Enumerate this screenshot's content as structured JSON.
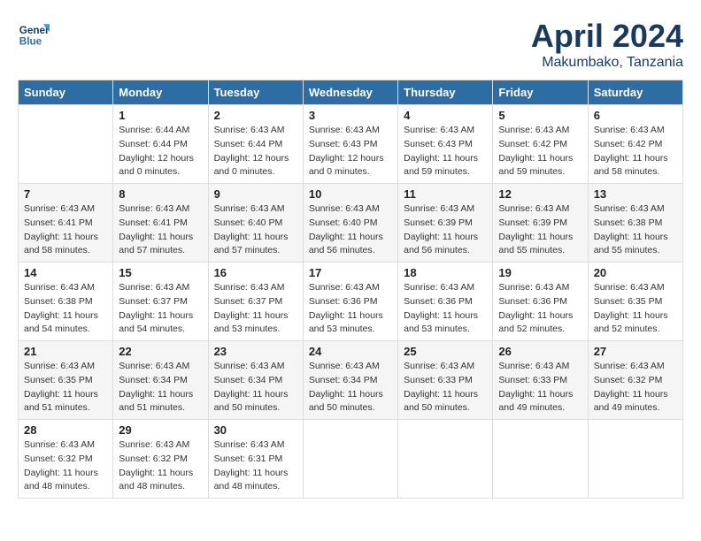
{
  "header": {
    "logo_line1": "General",
    "logo_line2": "Blue",
    "title": "April 2024",
    "subtitle": "Makumbako, Tanzania"
  },
  "weekdays": [
    "Sunday",
    "Monday",
    "Tuesday",
    "Wednesday",
    "Thursday",
    "Friday",
    "Saturday"
  ],
  "weeks": [
    [
      {
        "day": null,
        "info": null
      },
      {
        "day": "1",
        "sunrise": "6:44 AM",
        "sunset": "6:44 PM",
        "daylight": "12 hours and 0 minutes."
      },
      {
        "day": "2",
        "sunrise": "6:43 AM",
        "sunset": "6:44 PM",
        "daylight": "12 hours and 0 minutes."
      },
      {
        "day": "3",
        "sunrise": "6:43 AM",
        "sunset": "6:43 PM",
        "daylight": "12 hours and 0 minutes."
      },
      {
        "day": "4",
        "sunrise": "6:43 AM",
        "sunset": "6:43 PM",
        "daylight": "11 hours and 59 minutes."
      },
      {
        "day": "5",
        "sunrise": "6:43 AM",
        "sunset": "6:42 PM",
        "daylight": "11 hours and 59 minutes."
      },
      {
        "day": "6",
        "sunrise": "6:43 AM",
        "sunset": "6:42 PM",
        "daylight": "11 hours and 58 minutes."
      }
    ],
    [
      {
        "day": "7",
        "sunrise": "6:43 AM",
        "sunset": "6:41 PM",
        "daylight": "11 hours and 58 minutes."
      },
      {
        "day": "8",
        "sunrise": "6:43 AM",
        "sunset": "6:41 PM",
        "daylight": "11 hours and 57 minutes."
      },
      {
        "day": "9",
        "sunrise": "6:43 AM",
        "sunset": "6:40 PM",
        "daylight": "11 hours and 57 minutes."
      },
      {
        "day": "10",
        "sunrise": "6:43 AM",
        "sunset": "6:40 PM",
        "daylight": "11 hours and 56 minutes."
      },
      {
        "day": "11",
        "sunrise": "6:43 AM",
        "sunset": "6:39 PM",
        "daylight": "11 hours and 56 minutes."
      },
      {
        "day": "12",
        "sunrise": "6:43 AM",
        "sunset": "6:39 PM",
        "daylight": "11 hours and 55 minutes."
      },
      {
        "day": "13",
        "sunrise": "6:43 AM",
        "sunset": "6:38 PM",
        "daylight": "11 hours and 55 minutes."
      }
    ],
    [
      {
        "day": "14",
        "sunrise": "6:43 AM",
        "sunset": "6:38 PM",
        "daylight": "11 hours and 54 minutes."
      },
      {
        "day": "15",
        "sunrise": "6:43 AM",
        "sunset": "6:37 PM",
        "daylight": "11 hours and 54 minutes."
      },
      {
        "day": "16",
        "sunrise": "6:43 AM",
        "sunset": "6:37 PM",
        "daylight": "11 hours and 53 minutes."
      },
      {
        "day": "17",
        "sunrise": "6:43 AM",
        "sunset": "6:36 PM",
        "daylight": "11 hours and 53 minutes."
      },
      {
        "day": "18",
        "sunrise": "6:43 AM",
        "sunset": "6:36 PM",
        "daylight": "11 hours and 53 minutes."
      },
      {
        "day": "19",
        "sunrise": "6:43 AM",
        "sunset": "6:36 PM",
        "daylight": "11 hours and 52 minutes."
      },
      {
        "day": "20",
        "sunrise": "6:43 AM",
        "sunset": "6:35 PM",
        "daylight": "11 hours and 52 minutes."
      }
    ],
    [
      {
        "day": "21",
        "sunrise": "6:43 AM",
        "sunset": "6:35 PM",
        "daylight": "11 hours and 51 minutes."
      },
      {
        "day": "22",
        "sunrise": "6:43 AM",
        "sunset": "6:34 PM",
        "daylight": "11 hours and 51 minutes."
      },
      {
        "day": "23",
        "sunrise": "6:43 AM",
        "sunset": "6:34 PM",
        "daylight": "11 hours and 50 minutes."
      },
      {
        "day": "24",
        "sunrise": "6:43 AM",
        "sunset": "6:34 PM",
        "daylight": "11 hours and 50 minutes."
      },
      {
        "day": "25",
        "sunrise": "6:43 AM",
        "sunset": "6:33 PM",
        "daylight": "11 hours and 50 minutes."
      },
      {
        "day": "26",
        "sunrise": "6:43 AM",
        "sunset": "6:33 PM",
        "daylight": "11 hours and 49 minutes."
      },
      {
        "day": "27",
        "sunrise": "6:43 AM",
        "sunset": "6:32 PM",
        "daylight": "11 hours and 49 minutes."
      }
    ],
    [
      {
        "day": "28",
        "sunrise": "6:43 AM",
        "sunset": "6:32 PM",
        "daylight": "11 hours and 48 minutes."
      },
      {
        "day": "29",
        "sunrise": "6:43 AM",
        "sunset": "6:32 PM",
        "daylight": "11 hours and 48 minutes."
      },
      {
        "day": "30",
        "sunrise": "6:43 AM",
        "sunset": "6:31 PM",
        "daylight": "11 hours and 48 minutes."
      },
      {
        "day": null,
        "info": null
      },
      {
        "day": null,
        "info": null
      },
      {
        "day": null,
        "info": null
      },
      {
        "day": null,
        "info": null
      }
    ]
  ],
  "labels": {
    "sunrise": "Sunrise:",
    "sunset": "Sunset:",
    "daylight": "Daylight:"
  }
}
